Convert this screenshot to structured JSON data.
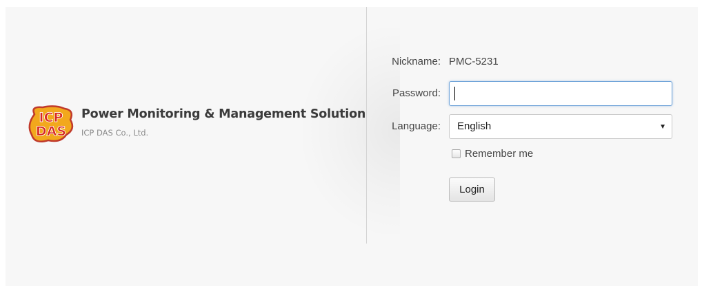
{
  "brand": {
    "title": "Power Monitoring & Management Solution",
    "subtitle": "ICP DAS Co., Ltd.",
    "logo_text": [
      "ICP",
      "DAS"
    ],
    "logo_colors": {
      "fill": "#f2a81d",
      "outline": "#c0392b",
      "letters": "#d7281f"
    }
  },
  "form": {
    "nickname_label": "Nickname:",
    "nickname_value": "PMC-5231",
    "password_label": "Password:",
    "password_value": "",
    "language_label": "Language:",
    "language_value": "English",
    "remember_label": "Remember me",
    "remember_checked": false,
    "login_label": "Login"
  },
  "colors": {
    "background": "#f7f7f7",
    "focus_border": "#6fa3d8"
  }
}
